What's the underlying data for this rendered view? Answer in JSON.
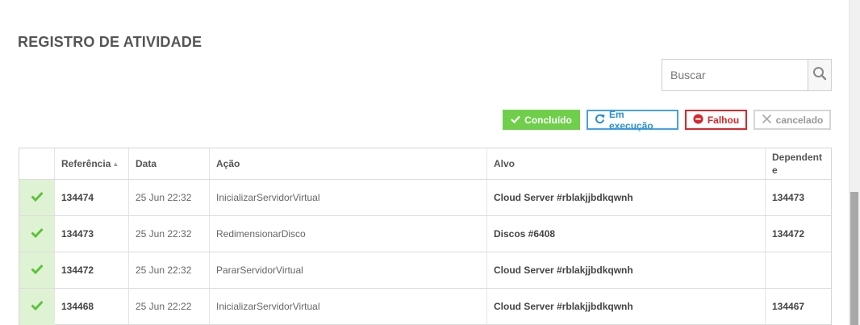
{
  "activity": {
    "title": "REGISTRO DE ATIVIDADE",
    "search": {
      "placeholder": "Buscar",
      "value": "",
      "icon": "search-icon"
    },
    "filters": [
      {
        "label": "Concluído",
        "icon": "check-icon",
        "color": "#6fcf4b"
      },
      {
        "label": "Em execução",
        "icon": "refresh-icon",
        "color": "#45a3e3"
      },
      {
        "label": "Falhou",
        "icon": "minus-circle-icon",
        "color": "#d9262e"
      },
      {
        "label": "cancelado",
        "icon": "close-icon",
        "color": "#999999"
      }
    ],
    "table": {
      "columns": [
        "",
        "Referência",
        "Data",
        "Ação",
        "Alvo",
        "Dependente"
      ],
      "sort": {
        "column": "Referência",
        "direction": "ascending"
      },
      "rows": [
        {
          "status": "completed",
          "reference": "134474",
          "date": "25 Jun 22:32",
          "action": "InicializarServidorVirtual",
          "target": "Cloud Server #rblakjjbdkqwnh",
          "dependent": "134473"
        },
        {
          "status": "completed",
          "reference": "134473",
          "date": "25 Jun 22:32",
          "action": "RedimensionarDisco",
          "target": "Discos #6408",
          "dependent": "134472"
        },
        {
          "status": "completed",
          "reference": "134472",
          "date": "25 Jun 22:32",
          "action": "PararServidorVirtual",
          "target": "Cloud Server #rblakjjbdkqwnh",
          "dependent": ""
        },
        {
          "status": "completed",
          "reference": "134468",
          "date": "25 Jun 22:22",
          "action": "InicializarServidorVirtual",
          "target": "Cloud Server #rblakjjbdkqwnh",
          "dependent": "134467"
        }
      ]
    }
  },
  "colors": {
    "status_completed_bg": "#dff3d4",
    "check": "#5cc43a"
  }
}
